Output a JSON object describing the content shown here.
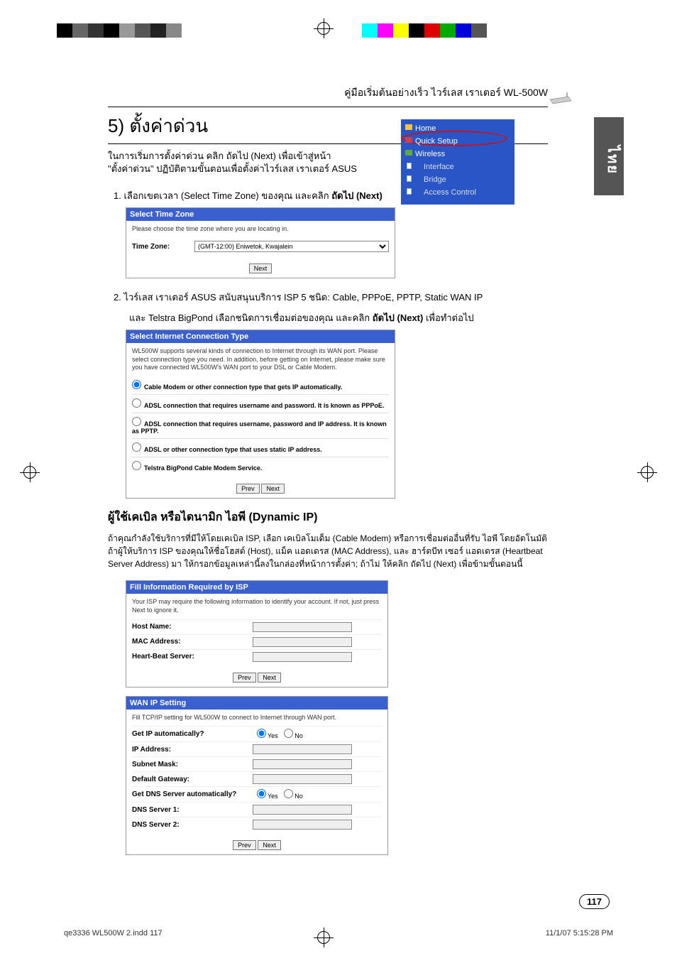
{
  "header_title": "คู่มือเริ่มต้นอย่างเร็ว ไวร์เลส เราเตอร์ WL-500W",
  "section_title": "5) ตั้งค่าด่วน",
  "intro_line1": "ในการเริ่มการตั้งค่าด่วน คลิก ถัดไป (Next) เพื่อเข้าสู่หน้า",
  "intro_line2": "\"ตั้งค่าด่วน\" ปฏิบัติตามขั้นตอนเพื่อตั้งค่าไวร์เลส เราเตอร์ ASUS",
  "language_tab": "ไทย",
  "side_menu": {
    "home": "Home",
    "quick": "Quick Setup",
    "wireless": "Wireless",
    "interface": "Interface",
    "bridge": "Bridge",
    "access": "Access Control"
  },
  "step1": "1.  เลือกเขตเวลา (Select Time Zone) ของคุณ และคลิก ",
  "step1_bold": "ถัดไป (Next)",
  "tz_panel": {
    "title": "Select Time Zone",
    "desc": "Please choose the time zone where you are locating in.",
    "label": "Time Zone:",
    "value": "(GMT-12:00) Eniwetok, Kwajalein",
    "next": "Next"
  },
  "step2a": "2.  ไวร์เลส เราเตอร์ ASUS สนับสนุนบริการ ISP 5 ชนิด: Cable, PPPoE, PPTP, Static WAN IP",
  "step2b": "และ Telstra BigPond เลือกชนิดการเชื่อมต่อของคุณ และคลิก ",
  "step2b_bold": "ถัดไป (Next)",
  "step2b_tail": " เพื่อทำต่อไป",
  "conn_panel": {
    "title": "Select Internet Connection Type",
    "desc": "WL500W supports several kinds of connection to Internet through its WAN port. Please select connection type you need. In addition, before getting on Internet, please make sure you have connected WL500W's WAN port to your DSL or Cable Modem.",
    "opt1": "Cable Modem or other connection type that gets IP automatically.",
    "opt2": "ADSL connection that requires username and password. It is known as PPPoE.",
    "opt3": "ADSL connection that requires username, password and IP address. It is known as PPTP.",
    "opt4": "ADSL or other connection type that uses static IP address.",
    "opt5": "Telstra BigPond Cable Modem Service.",
    "prev": "Prev",
    "next": "Next"
  },
  "sub_title": "ผู้ใช้เคเบิล หรือไดนามิก ไอพี (Dynamic IP)",
  "para": "ถ้าคุณกำลังใช้บริการที่มีให้โดยเคเบิล ISP, เลือก เคเบิลโมเด็ม (Cable Modem) หรือการเชื่อมต่ออื่นที่รับ ไอพี โดยอัตโนมัติ ถ้าผู้ให้บริการ ISP ของคุณให้ชื่อโฮสต์ (Host), แม็ค แอดเดรส (MAC Address), และ ฮาร์ตบีท เซอร์ แอดเดรส (Heartbeat Server Address) มา ให้กรอกข้อมูลเหล่านี้ลงในกล่องที่หน้าการตั้งค่า; ถ้าไม่ ให้คลิก ถัดไป (Next) เพื่อข้ามขั้นตอนนี้",
  "isp_panel": {
    "title": "Fill Information Required by ISP",
    "desc": "Your ISP may require the following information to identify your account. If not, just press Next to ignore it.",
    "host": "Host Name:",
    "mac": "MAC Address:",
    "hb": "Heart-Beat Server:",
    "prev": "Prev",
    "next": "Next"
  },
  "wan_panel": {
    "title": "WAN IP Setting",
    "desc": "Fill TCP/IP setting for WL500W to connect to Internet through WAN port.",
    "get_ip": "Get IP automatically?",
    "ip": "IP Address:",
    "mask": "Subnet Mask:",
    "gw": "Default Gateway:",
    "get_dns": "Get DNS Server automatically?",
    "dns1": "DNS Server 1:",
    "dns2": "DNS Server 2:",
    "yes": "Yes",
    "no": "No",
    "prev": "Prev",
    "next": "Next"
  },
  "page_num": "117",
  "footer_left": "qe3336 WL500W 2.indd   117",
  "footer_right": "11/1/07   5:15:28 PM"
}
